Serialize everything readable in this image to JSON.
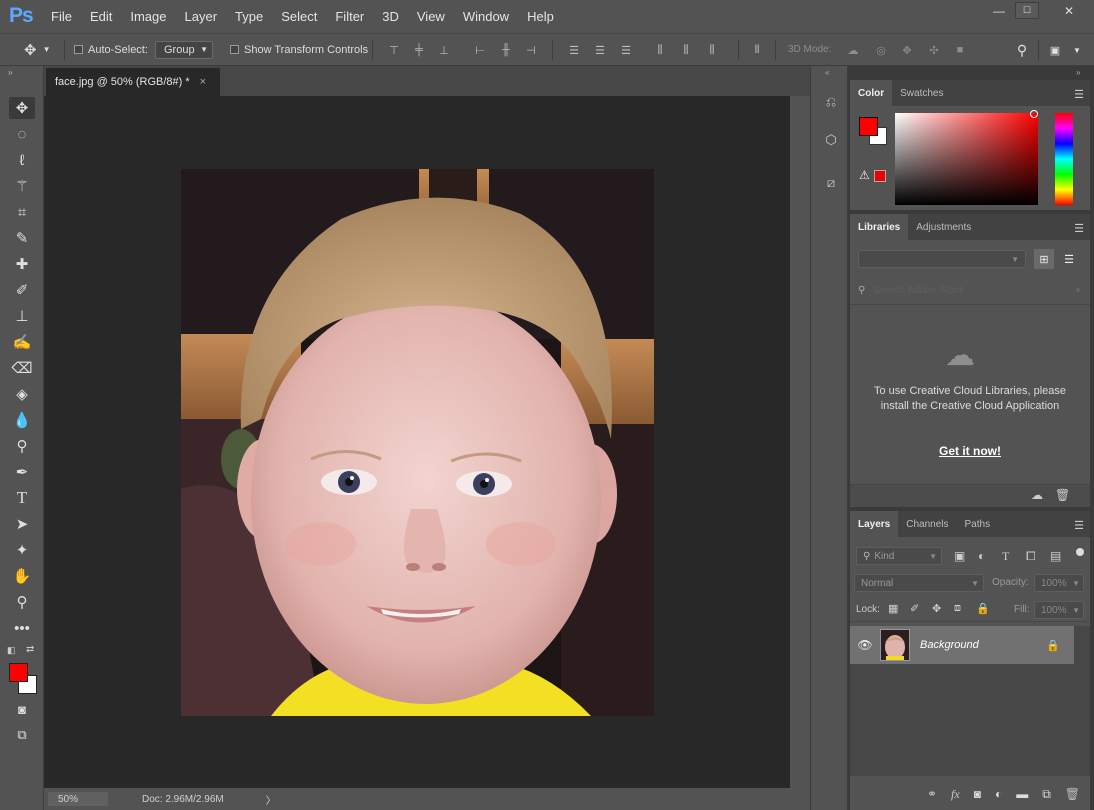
{
  "app": {
    "logo": "Ps"
  },
  "menu": [
    "File",
    "Edit",
    "Image",
    "Layer",
    "Type",
    "Select",
    "Filter",
    "3D",
    "View",
    "Window",
    "Help"
  ],
  "window_controls": {
    "minimize": "—",
    "maximize": "☐",
    "close": "✕"
  },
  "options_bar": {
    "auto_select_label": "Auto-Select:",
    "auto_select_value": "Group",
    "show_transform_label": "Show Transform Controls",
    "mode_3d_label": "3D Mode:"
  },
  "document": {
    "tab_title": "face.jpg @ 50% (RGB/8#) *",
    "tab_close": "×",
    "zoom": "50%",
    "doc_info": "Doc: 2.96M/2.96M",
    "status_arrow": "〉"
  },
  "color_panel": {
    "tabs": [
      "Color",
      "Swatches"
    ],
    "foreground": "#ff0000",
    "background": "#ffffff"
  },
  "libraries_panel": {
    "tabs": [
      "Libraries",
      "Adjustments"
    ],
    "search_placeholder": "Search Adobe Stock",
    "message": "To use Creative Cloud Libraries, please install the Creative Cloud Application",
    "link": "Get it now!"
  },
  "layers_panel": {
    "tabs": [
      "Layers",
      "Channels",
      "Paths"
    ],
    "filter_label": "Kind",
    "blend_mode": "Normal",
    "opacity_label": "Opacity:",
    "opacity_value": "100%",
    "lock_label": "Lock:",
    "fill_label": "Fill:",
    "fill_value": "100%",
    "layers": [
      {
        "name": "Background",
        "visible": true,
        "locked": true
      }
    ]
  },
  "colors": {
    "accent": "#5aa8ff",
    "ui_bg": "#535353",
    "canvas_bg": "#282828",
    "fg_swatch": "#ff0000"
  }
}
